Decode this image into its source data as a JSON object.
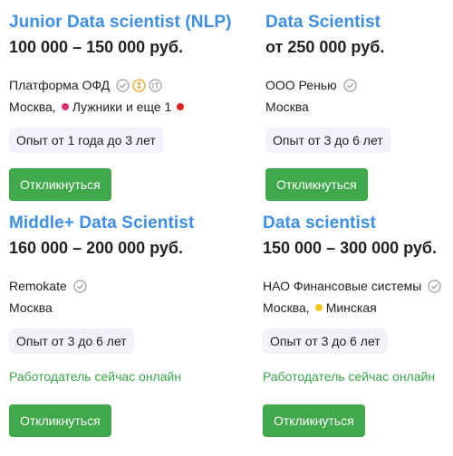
{
  "vacancies": [
    {
      "title": "Junior Data scientist (NLP)",
      "salary": "100 000 – 150 000 руб.",
      "company": "Платформа ОФД",
      "location_city": "Москва,",
      "metro": "Лужники и еще 1",
      "experience": "Опыт от 1 года до 3 лет",
      "apply_label": "Откликнуться",
      "metro_color": "#d6336c"
    },
    {
      "title": "Data Scientist",
      "salary": "от 250 000 руб.",
      "company": "ООО Ренью",
      "location_city": "Москва",
      "experience": "Опыт от 3 до 6 лет",
      "apply_label": "Откликнуться"
    },
    {
      "title": "Middle+ Data Scientist",
      "salary": "160 000 – 200 000 руб.",
      "company": "Remokate",
      "location_city": "Москва",
      "experience": "Опыт от 3 до 6 лет",
      "online_status": "Работодатель сейчас онлайн",
      "apply_label": "Откликнуться"
    },
    {
      "title": "Data scientist",
      "salary": "150 000 – 300 000 руб.",
      "company": "НАО Финансовые системы",
      "location_city": "Москва,",
      "metro": "Минская",
      "experience": "Опыт от 3 до 6 лет",
      "online_status": "Работодатель сейчас онлайн",
      "apply_label": "Откликнуться",
      "metro_color": "#f5c518"
    }
  ],
  "colors": {
    "title": "#3d8ee6",
    "button": "#40a94b",
    "online": "#3aa44b",
    "experience_bg": "#f4f1fa"
  }
}
